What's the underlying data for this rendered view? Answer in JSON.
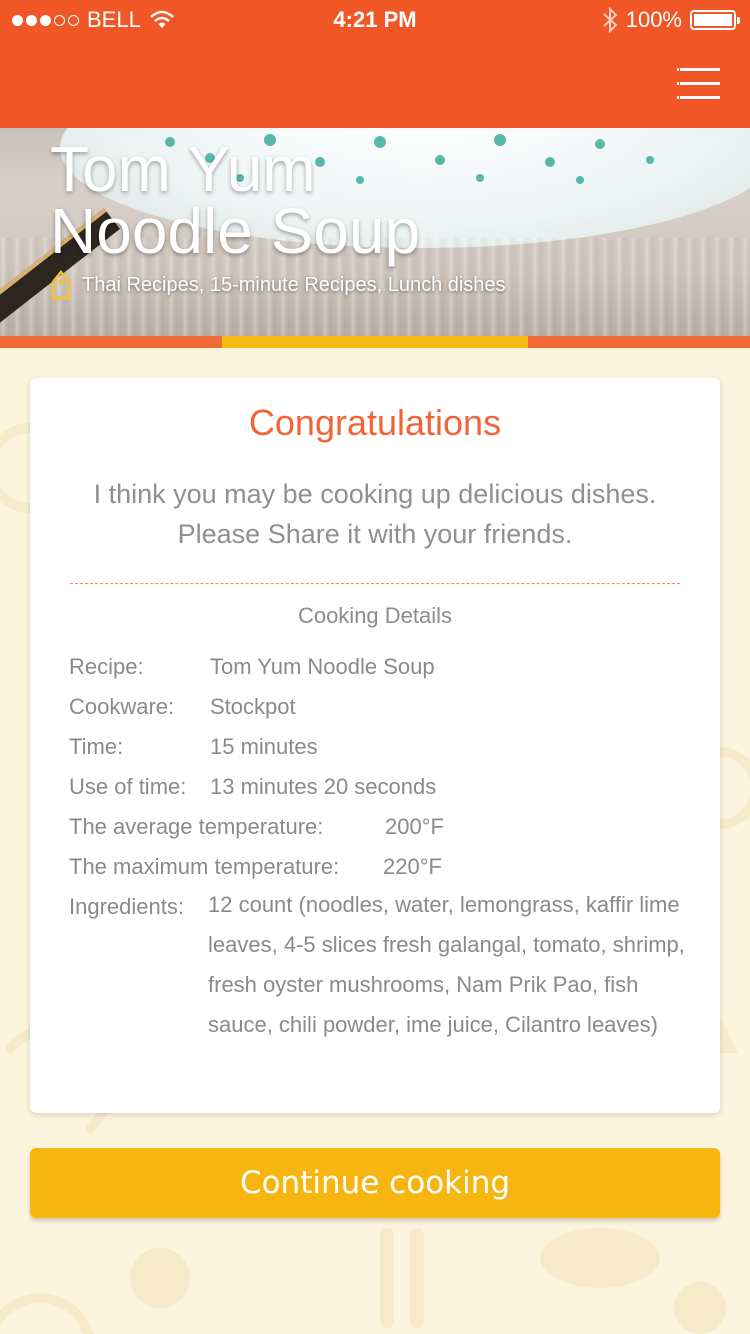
{
  "status_bar": {
    "carrier": "BELL",
    "time": "4:21 PM",
    "battery_percent": "100%",
    "signal_bars": 3,
    "signal_total": 5
  },
  "header": {
    "menu_icon": "hamburger-menu-icon",
    "background_color": "#f15627"
  },
  "hero": {
    "title_line1": "Tom Yum",
    "title_line2": "Noodle Soup",
    "categories": "Thai Recipes, 15-minute Recipes, Lunch dishes",
    "tag_icon": "tag-icon"
  },
  "progress": {
    "segment_color": "#f8bb12",
    "track_color": "#f26a35"
  },
  "card": {
    "title": "Congratulations",
    "message": "I think you may be cooking up delicious dishes. Please Share it with your friends.",
    "details_title": "Cooking Details",
    "details": {
      "recipe_label": "Recipe:",
      "recipe_value": "Tom Yum Noodle Soup",
      "cookware_label": "Cookware:",
      "cookware_value": "Stockpot",
      "time_label": "Time:",
      "time_value": "15 minutes",
      "use_of_time_label": "Use of time:",
      "use_of_time_value": "13 minutes 20 seconds",
      "avg_temp_label": "The average temperature:",
      "avg_temp_value": "200°F",
      "max_temp_label": "The maximum temperature:",
      "max_temp_value": "220°F",
      "ingredients_label": "Ingredients:",
      "ingredients_value": "12 count (noodles, water, lemongrass, kaffir lime leaves, 4-5 slices fresh galangal, tomato, shrimp, fresh oyster mushrooms, Nam Prik Pao, fish sauce, chili powder, ime juice, Cilantro leaves)"
    }
  },
  "actions": {
    "continue_label": "Continue cooking",
    "continue_color": "#f7b510"
  }
}
